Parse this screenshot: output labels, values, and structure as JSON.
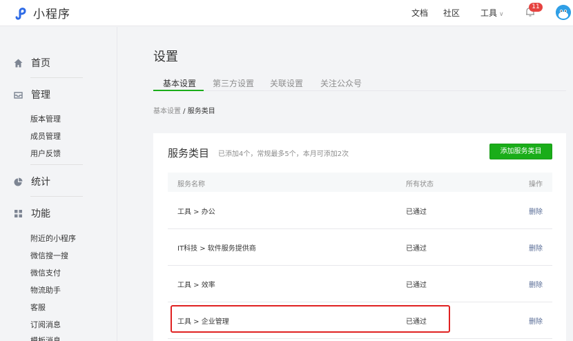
{
  "app": {
    "name": "小程序",
    "accent": "#1aad19",
    "brand": "#2e6be6",
    "highlight": "#e02020"
  },
  "topnav": {
    "docs": "文档",
    "community": "社区",
    "tools": "工具",
    "badge": "11"
  },
  "sidebar": {
    "home": "首页",
    "manage": "管理",
    "manage_items": [
      "版本管理",
      "成员管理",
      "用户反馈"
    ],
    "stats": "统计",
    "features": "功能",
    "feature_items": [
      "附近的小程序",
      "微信搜一搜",
      "微信支付",
      "物流助手",
      "客服",
      "订阅消息",
      "模板消息"
    ]
  },
  "main": {
    "title": "设置",
    "tabs": [
      "基本设置",
      "第三方设置",
      "关联设置",
      "关注公众号"
    ],
    "breadcrumb": {
      "parent": "基本设置",
      "separator": " / ",
      "current": "服务类目"
    },
    "card": {
      "title": "服务类目",
      "note": "已添加4个，常规最多5个，本月可添加2次",
      "add_button": "添加服务类目",
      "columns": [
        "服务名称",
        "所有状态",
        "操作"
      ],
      "rows": [
        {
          "name": "工具 > 办公",
          "status": "已通过",
          "action": "删除"
        },
        {
          "name": "IT科技 > 软件服务提供商",
          "status": "已通过",
          "action": "删除"
        },
        {
          "name": "工具 > 效率",
          "status": "已通过",
          "action": "删除"
        },
        {
          "name": "工具 > 企业管理",
          "status": "已通过",
          "action": "删除"
        }
      ]
    }
  }
}
